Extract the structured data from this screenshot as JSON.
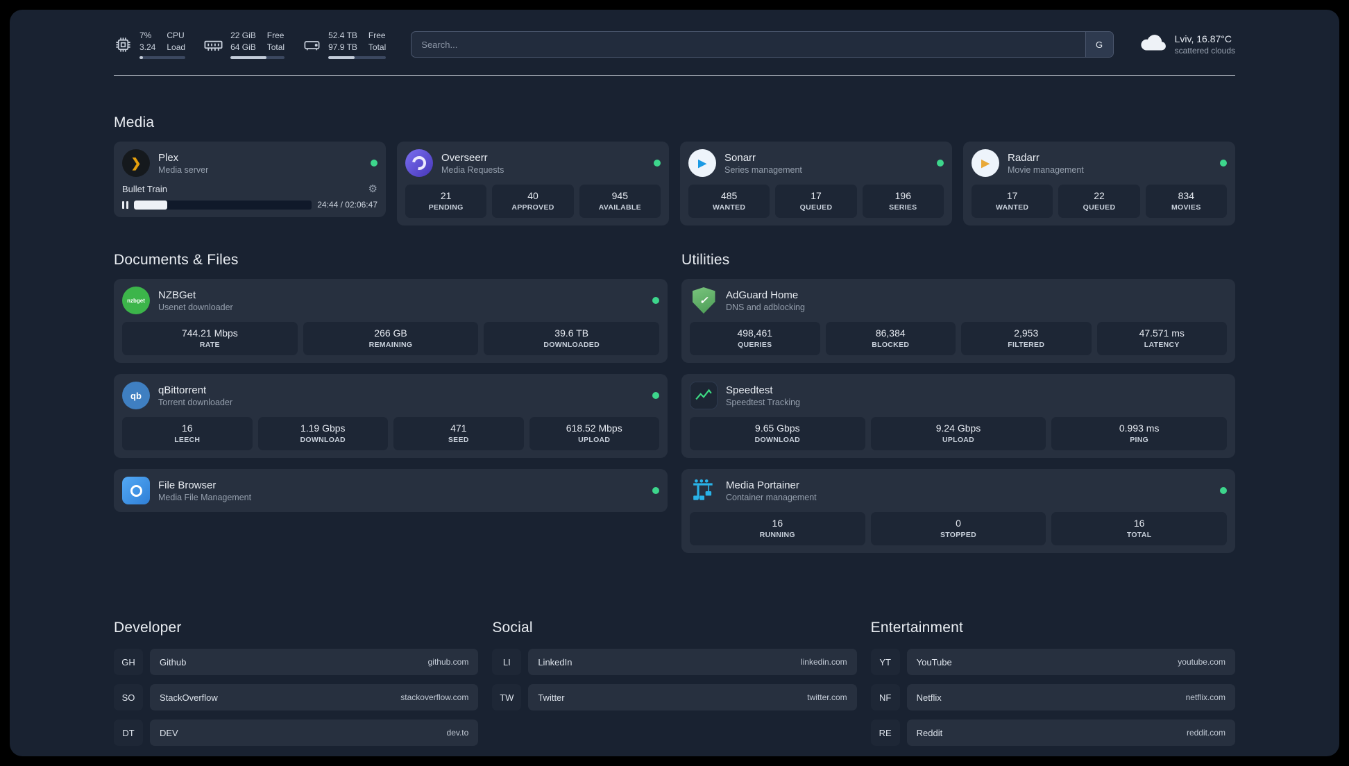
{
  "topbar": {
    "cpu": {
      "value_top": "7%",
      "value_bottom": "3.24",
      "label_top": "CPU",
      "label_bottom": "Load",
      "bar_percent": 7
    },
    "memory": {
      "value_top": "22 GiB",
      "value_bottom": "64 GiB",
      "label_top": "Free",
      "label_bottom": "Total",
      "bar_percent": 66
    },
    "disk": {
      "value_top": "52.4 TB",
      "value_bottom": "97.9 TB",
      "label_top": "Free",
      "label_bottom": "Total",
      "bar_percent": 46
    },
    "search": {
      "placeholder": "Search...",
      "provider_label": "G"
    },
    "weather": {
      "location": "Lviv, 16.87°C",
      "condition": "scattered clouds"
    }
  },
  "sections": {
    "media": {
      "title": "Media",
      "cards": [
        {
          "id": "plex",
          "icon": "plex-icon",
          "name": "Plex",
          "description": "Media server",
          "status": "online",
          "player": {
            "title": "Bullet Train",
            "time": "24:44 / 02:06:47",
            "progress_percent": 19
          }
        },
        {
          "id": "overseerr",
          "icon": "overseerr-icon",
          "name": "Overseerr",
          "description": "Media Requests",
          "status": "online",
          "stats": [
            {
              "value": "21",
              "label": "PENDING"
            },
            {
              "value": "40",
              "label": "APPROVED"
            },
            {
              "value": "945",
              "label": "AVAILABLE"
            }
          ]
        },
        {
          "id": "sonarr",
          "icon": "sonarr-icon",
          "name": "Sonarr",
          "description": "Series management",
          "status": "online",
          "stats": [
            {
              "value": "485",
              "label": "WANTED"
            },
            {
              "value": "17",
              "label": "QUEUED"
            },
            {
              "value": "196",
              "label": "SERIES"
            }
          ]
        },
        {
          "id": "radarr",
          "icon": "radarr-icon",
          "name": "Radarr",
          "description": "Movie management",
          "status": "online",
          "stats": [
            {
              "value": "17",
              "label": "WANTED"
            },
            {
              "value": "22",
              "label": "QUEUED"
            },
            {
              "value": "834",
              "label": "MOVIES"
            }
          ]
        }
      ]
    },
    "documents": {
      "title": "Documents & Files",
      "cards": [
        {
          "id": "nzbget",
          "icon": "nzbget-icon",
          "name": "NZBGet",
          "description": "Usenet downloader",
          "status": "online",
          "stats": [
            {
              "value": "744.21 Mbps",
              "label": "RATE"
            },
            {
              "value": "266 GB",
              "label": "REMAINING"
            },
            {
              "value": "39.6 TB",
              "label": "DOWNLOADED"
            }
          ]
        },
        {
          "id": "qbittorrent",
          "icon": "qbittorrent-icon",
          "name": "qBittorrent",
          "description": "Torrent downloader",
          "status": "online",
          "stats": [
            {
              "value": "16",
              "label": "LEECH"
            },
            {
              "value": "1.19 Gbps",
              "label": "DOWNLOAD"
            },
            {
              "value": "471",
              "label": "SEED"
            },
            {
              "value": "618.52 Mbps",
              "label": "UPLOAD"
            }
          ]
        },
        {
          "id": "filebrowser",
          "icon": "filebrowser-icon",
          "name": "File Browser",
          "description": "Media File Management",
          "status": "online"
        }
      ]
    },
    "utilities": {
      "title": "Utilities",
      "cards": [
        {
          "id": "adguard",
          "icon": "adguard-icon",
          "name": "AdGuard Home",
          "description": "DNS and adblocking",
          "stats": [
            {
              "value": "498,461",
              "label": "QUERIES"
            },
            {
              "value": "86,384",
              "label": "BLOCKED"
            },
            {
              "value": "2,953",
              "label": "FILTERED"
            },
            {
              "value": "47.571 ms",
              "label": "LATENCY"
            }
          ]
        },
        {
          "id": "speedtest",
          "icon": "speedtest-icon",
          "name": "Speedtest",
          "description": "Speedtest Tracking",
          "stats": [
            {
              "value": "9.65 Gbps",
              "label": "DOWNLOAD"
            },
            {
              "value": "9.24 Gbps",
              "label": "UPLOAD"
            },
            {
              "value": "0.993 ms",
              "label": "PING"
            }
          ]
        },
        {
          "id": "portainer",
          "icon": "portainer-icon",
          "name": "Media Portainer",
          "description": "Container management",
          "status": "online",
          "stats": [
            {
              "value": "16",
              "label": "RUNNING"
            },
            {
              "value": "0",
              "label": "STOPPED"
            },
            {
              "value": "16",
              "label": "TOTAL"
            }
          ]
        }
      ]
    }
  },
  "bookmarks": [
    {
      "title": "Developer",
      "items": [
        {
          "abbr": "GH",
          "name": "Github",
          "url": "github.com"
        },
        {
          "abbr": "SO",
          "name": "StackOverflow",
          "url": "stackoverflow.com"
        },
        {
          "abbr": "DT",
          "name": "DEV",
          "url": "dev.to"
        }
      ]
    },
    {
      "title": "Social",
      "items": [
        {
          "abbr": "LI",
          "name": "LinkedIn",
          "url": "linkedin.com"
        },
        {
          "abbr": "TW",
          "name": "Twitter",
          "url": "twitter.com"
        }
      ]
    },
    {
      "title": "Entertainment",
      "items": [
        {
          "abbr": "YT",
          "name": "YouTube",
          "url": "youtube.com"
        },
        {
          "abbr": "NF",
          "name": "Netflix",
          "url": "netflix.com"
        },
        {
          "abbr": "RE",
          "name": "Reddit",
          "url": "reddit.com"
        }
      ]
    }
  ],
  "colors": {
    "status_online": "#3dd68c",
    "panel_bg": "#192231",
    "card_bg": "#27303f",
    "plex_accent": "#e5a00d"
  }
}
